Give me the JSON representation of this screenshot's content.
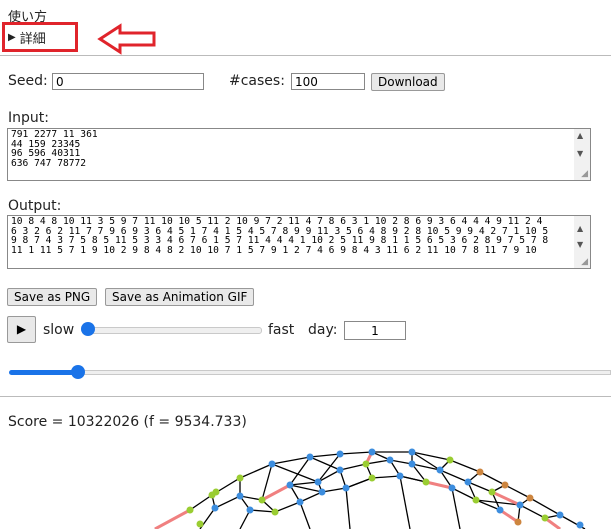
{
  "usage": {
    "title": "使い方",
    "details_label": "詳細"
  },
  "controls": {
    "seed_label": "Seed:",
    "seed_value": "0",
    "cases_label": "#cases:",
    "cases_value": "100",
    "download_label": "Download"
  },
  "input_section": {
    "label": "Input:",
    "text": "791 2277 11 361\n44 159 23345\n96 596 40311\n636 747 78772\n"
  },
  "output_section": {
    "label": "Output:",
    "text": "10 8 4 8 10 11 3 5 9 7 11 10 10 5 11 2 10 9 7 2 11 4 7 8 6 3 1 10 2 8 6 9 3 6 4 4 4 9 11 2 4\n6 3 2 6 2 11 7 7 9 6 9 3 6 4 5 1 7 4 1 5 4 5 7 8 9 9 11 3 5 6 4 8 9 2 8 10 5 9 9 4 2 7 1 10 5\n9 8 7 4 3 7 5 8 5 11 5 3 3 4 6 7 6 1 5 7 11 4 4 4 1 10 2 5 11 9 8 1 1 5 6 5 3 6 2 8 9 7 5 7 8\n11 1 11 5 7 1 9 10 2 9 8 4 8 2 10 10 7 1 5 7 9 1 2 7 4 6 9 8 4 3 11 6 2 11 10 7 8 11 7 9 10"
  },
  "buttons": {
    "save_png": "Save as PNG",
    "save_gif": "Save as Animation GIF",
    "play": "▶"
  },
  "playback": {
    "slow_label": "slow",
    "fast_label": "fast",
    "day_label": "day:",
    "day_value": "1"
  },
  "score": {
    "text": "Score = 10322026 (f = 9534.733)"
  },
  "colors": {
    "accent": "#1a73e8",
    "annotation": "#e0242b",
    "edge": "#000000",
    "highlight_edge": "#f08080"
  }
}
